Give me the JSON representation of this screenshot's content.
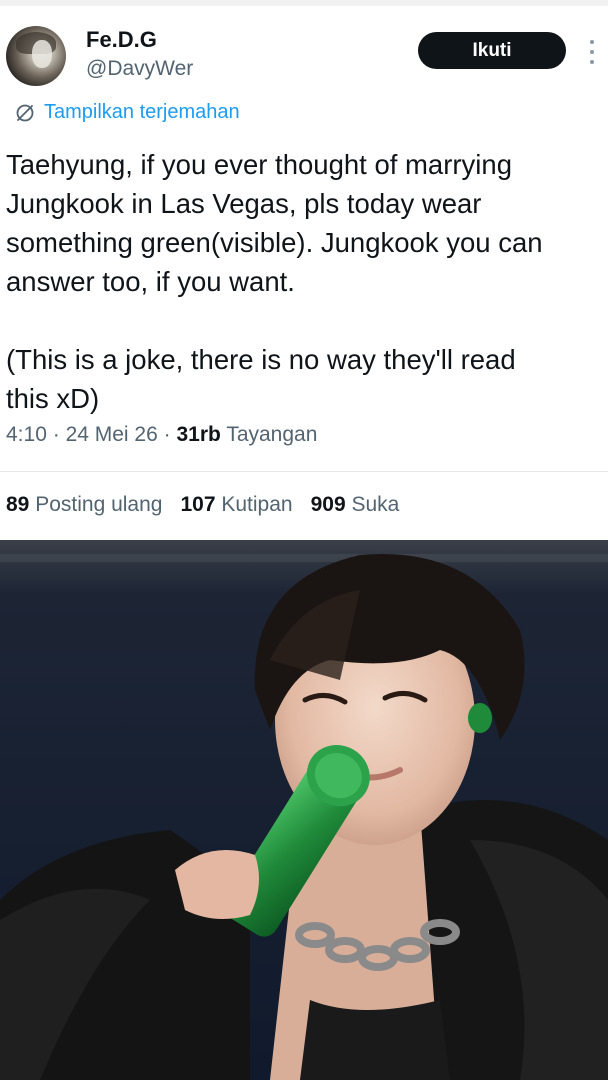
{
  "user": {
    "display_name": "Fe.D.G",
    "handle": "@DavyWer"
  },
  "actions": {
    "follow_label": "Ikuti",
    "translate_label": "Tampilkan terjemahan"
  },
  "tweet": {
    "paragraph1": "Taehyung, if you ever thought of marrying\nJungkook in Las Vegas, pls today wear\nsomething green(visible). Jungkook you can\nanswer too, if you want.",
    "paragraph2": "(This is a joke, there is no way they'll read\nthis xD)",
    "time": "4:10",
    "date": "24 Mei 26",
    "views_count": "31rb",
    "views_label": "Tayangan",
    "separator": "·"
  },
  "stats": {
    "reposts_count": "89",
    "reposts_label": "Posting ulang",
    "quotes_count": "107",
    "quotes_label": "Kutipan",
    "likes_count": "909",
    "likes_label": "Suka"
  },
  "icons": {
    "translate": "translate-icon",
    "more": "more-options-icon"
  },
  "colors": {
    "accent": "#1d9bf0",
    "follow_button": "#0f1419",
    "secondary_text": "#536471",
    "microphone": "#1f8a3a"
  }
}
